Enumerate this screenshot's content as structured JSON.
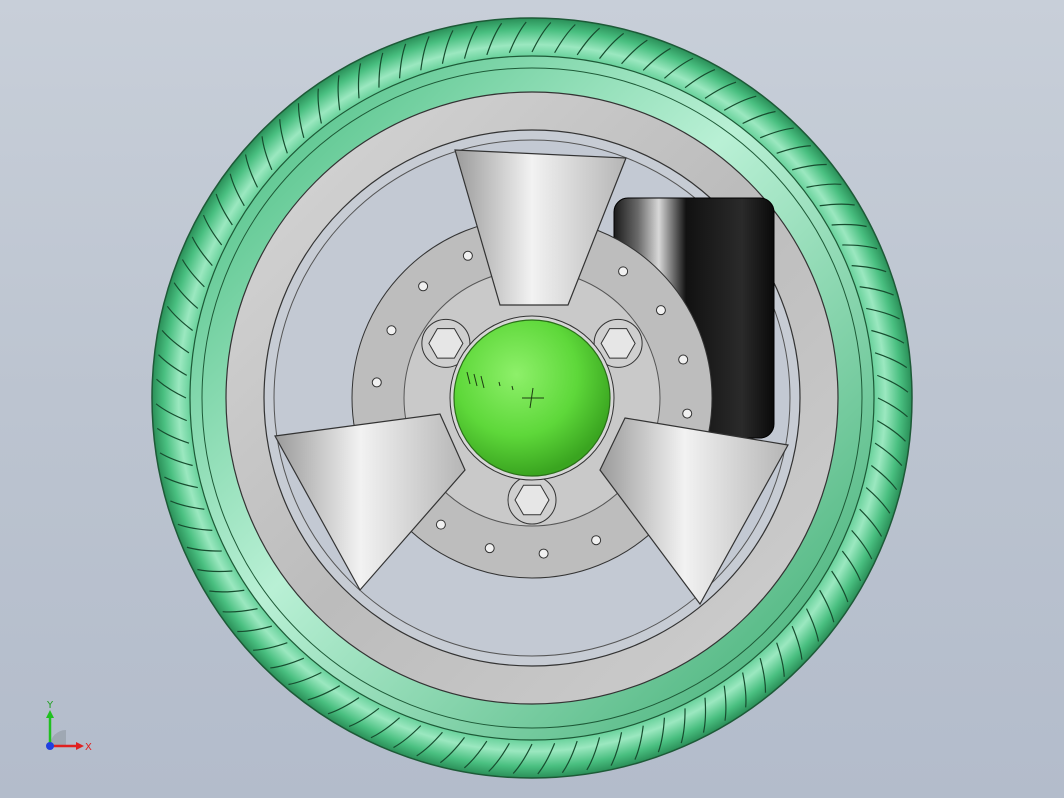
{
  "viewport": {
    "background_top": "#c8cfd9",
    "background_bottom": "#b3bccb"
  },
  "model": {
    "tire_color": "#3fb97a",
    "tire_dark": "#2a8f58",
    "rim_color": "#c9c9c9",
    "hub_cap_color": "#5ed83a",
    "disc_color": "#b9b9b9",
    "caliper_color": "#1a1a1a",
    "spoke_count": 3,
    "bolt_count": 3,
    "disc_hole_count": 18
  },
  "triad": {
    "x_label": "X",
    "y_label": "Y",
    "x_color": "#e02020",
    "y_color": "#20c020",
    "z_color": "#2040e0"
  }
}
